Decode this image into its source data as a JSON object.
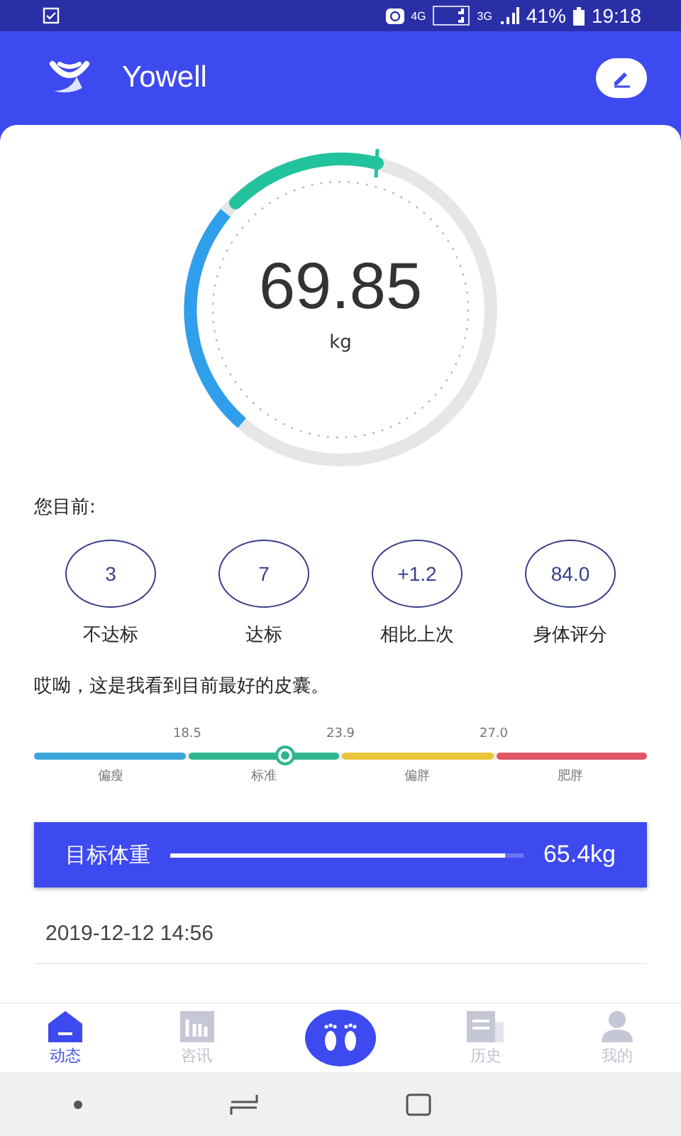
{
  "status_bar": {
    "network_4g": "4G",
    "network_3g": "3G",
    "battery": "41%",
    "time": "19:18"
  },
  "app_bar": {
    "title": "Yowell"
  },
  "weight": {
    "value": "69.85",
    "unit": "kg"
  },
  "summary": {
    "heading": "您目前:",
    "stats": [
      {
        "value": "3",
        "label": "不达标"
      },
      {
        "value": "7",
        "label": "达标"
      },
      {
        "value": "+1.2",
        "label": "相比上次"
      },
      {
        "value": "84.0",
        "label": "身体评分"
      }
    ]
  },
  "comment": "哎呦，这是我看到目前最好的皮囊。",
  "bmi_scale": {
    "level": 0.41,
    "thresholds": [
      "18.5",
      "23.9",
      "27.0"
    ],
    "segments": [
      {
        "label": "偏瘦",
        "color": "#3aa7db"
      },
      {
        "label": "标准",
        "color": "#2fb68e"
      },
      {
        "label": "偏胖",
        "color": "#e8c43a"
      },
      {
        "label": "肥胖",
        "color": "#e05866"
      }
    ]
  },
  "target": {
    "label": "目标体重",
    "level": 0.94,
    "value": "65.4kg"
  },
  "record_date": "2019-12-12 14:56",
  "bottom_nav": [
    {
      "kind": "tab",
      "label": "动态",
      "selected": true
    },
    {
      "kind": "tab",
      "label": "咨讯",
      "selected": false
    },
    {
      "kind": "center"
    },
    {
      "kind": "tab",
      "label": "历史",
      "selected": false
    },
    {
      "kind": "tab",
      "label": "我的",
      "selected": false
    }
  ]
}
